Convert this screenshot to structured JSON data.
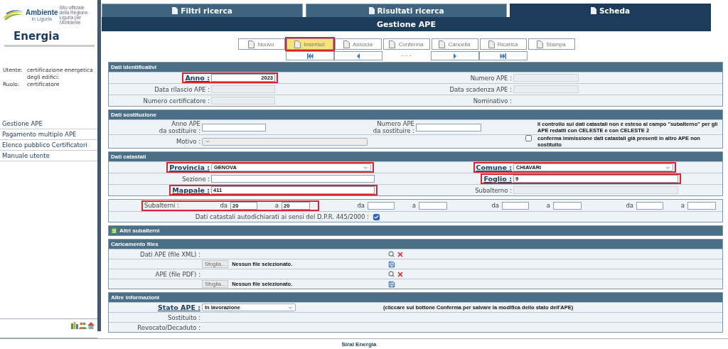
{
  "sidebar": {
    "logo": {
      "name": "Ambiente",
      "region": "in Liguria",
      "tagline": "Sito ufficiale della Regione Liguria per l'Ambiente"
    },
    "app_name": "Energia",
    "user_label": "Utente:",
    "user": "certificazione energetica degli edifici:",
    "role_label": "Ruolo:",
    "role": "certificatore",
    "menu": [
      {
        "label": "Gestione APE"
      },
      {
        "label": "Pagamento multiplo APE"
      },
      {
        "label": "Elenco pubblico Certificatori"
      },
      {
        "label": "Manuale utente"
      }
    ]
  },
  "tabs": [
    {
      "label": "Filtri ricerca",
      "selected": false
    },
    {
      "label": "Risultati ricerca",
      "selected": false
    },
    {
      "label": "Scheda",
      "selected": true
    }
  ],
  "title": "Gestione APE",
  "toolbar": [
    {
      "label": "Nuovo",
      "selected": false,
      "highlighted": false
    },
    {
      "label": "Inserisci",
      "selected": true,
      "highlighted": true
    },
    {
      "label": "Associa",
      "selected": false,
      "highlighted": false
    },
    {
      "label": "Conferma",
      "selected": false,
      "highlighted": false
    },
    {
      "label": "Cancella",
      "selected": false,
      "highlighted": false
    },
    {
      "label": "Ricarica",
      "selected": false,
      "highlighted": false
    },
    {
      "label": "Stampa",
      "selected": false,
      "highlighted": false
    }
  ],
  "navigation": {
    "status": "- - -"
  },
  "dati_identificativi": {
    "title": "Dati identificativi",
    "fields": [
      {
        "label": "Anno :",
        "kind": "input",
        "value": "2023",
        "required": true,
        "highlighted": true,
        "disabled": false
      },
      {
        "label": "Numero APE :",
        "kind": "input",
        "required": false,
        "highlighted": false,
        "disabled": true
      },
      {
        "label": "Data rilascio APE :",
        "kind": "input",
        "required": false,
        "highlighted": false,
        "disabled": true
      },
      {
        "label": "Data scadenza APE :",
        "kind": "input",
        "required": false,
        "highlighted": false,
        "disabled": true
      },
      {
        "label": "Numero certificatore :",
        "kind": "input",
        "required": false,
        "highlighted": false,
        "disabled": true
      },
      {
        "label": "Nominativo :",
        "kind": "text",
        "required": false,
        "highlighted": false
      }
    ]
  },
  "dati_sostituzione": {
    "title": "Dati sostituzione",
    "fields": [
      {
        "label": "Anno APE\nda sostituire :",
        "kind": "input",
        "disabled": false
      },
      {
        "label": "Numero APE\nda sostituire :",
        "kind": "input",
        "disabled": false
      }
    ],
    "note": "Il controllo sui dati catastali non è esteso al campo \"subalterno\" per gli APE redatti con CELESTE e con CELESTE 2",
    "motivo": {
      "label": "Motivo :",
      "kind": "select",
      "disabled": true
    },
    "confirm": {
      "label": "conferma immissione dati catastali già presenti in altro APE non sostituito",
      "checked": false
    }
  },
  "dati_catastali": {
    "title": "Dati catastali",
    "fields": [
      {
        "label": "Provincia :",
        "kind": "select",
        "value": "GENOVA",
        "required": true,
        "highlighted": true,
        "disabled": false
      },
      {
        "label": "Comune :",
        "kind": "select",
        "value": "CHIAVARI",
        "required": true,
        "highlighted": true,
        "disabled": false
      },
      {
        "label": "Sezione :",
        "kind": "input",
        "required": false,
        "highlighted": false,
        "disabled": false
      },
      {
        "label": "Foglio :",
        "kind": "input",
        "value": "9",
        "required": true,
        "highlighted": true,
        "disabled": false
      },
      {
        "label": "Mappale :",
        "kind": "input",
        "value": "411",
        "required": true,
        "highlighted": true,
        "disabled": false
      },
      {
        "label": "Subalterno :",
        "kind": "input",
        "required": false,
        "highlighted": false,
        "disabled": true
      }
    ]
  },
  "subalterni": {
    "label": "Subalterni :",
    "highlighted": true,
    "ranges": [
      {
        "from_label": "da",
        "from": "20",
        "to_label": "a",
        "to": "20"
      },
      {
        "from_label": "da",
        "to_label": "a"
      },
      {
        "from_label": "da",
        "to_label": "a"
      },
      {
        "from_label": "da",
        "to_label": "a"
      }
    ],
    "declaration": {
      "label": "Dati catastali autodichiarati ai sensi del D.P.R. 445/2000 :",
      "checked": true
    }
  },
  "altri_subalterni": {
    "title": "Altri subalterni"
  },
  "caricamento_files": {
    "title": "Caricamento files",
    "files": [
      {
        "label": "Dati APE (file XML) :",
        "browse": "Sfoglia...",
        "status": "Nessun file selezionato."
      },
      {
        "label": "APE (file PDF) :",
        "browse": "Sfoglia...",
        "status": "Nessun file selezionato."
      }
    ]
  },
  "altre_informazioni": {
    "title": "Altre informazioni",
    "fields": [
      {
        "label": "Stato APE :",
        "kind": "select",
        "value": "In lavorazione",
        "required": true
      },
      {
        "label": "Sostituito :",
        "kind": "text",
        "required": false
      },
      {
        "label": "Revocato/Decaduto :",
        "kind": "text",
        "required": false
      }
    ],
    "hint": "(cliccare sul bottone Conferma per salvare la modifica dello stato dell'APE)"
  },
  "footer": "Siral Energia"
}
